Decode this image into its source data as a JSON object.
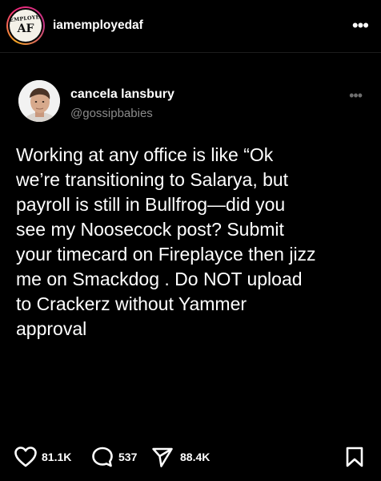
{
  "header": {
    "account_handle": "iamemployedaf",
    "more_icon": "more-horizontal-icon",
    "logo": {
      "top_text": "EMPLOYED",
      "bottom_text": "AF"
    }
  },
  "tweet": {
    "display_name": "cancela lansbury",
    "username": "@gossipbabies",
    "more_icon": "more-horizontal-icon",
    "text": "Working at any office is like “Ok\nwe’re transitioning to Salarya, but\npayroll is still in Bullfrog—did you\nsee my Noosecock post? Submit\nyour timecard on Fireplayce then jizz\nme on Smackdog . Do NOT upload\nto Crackerz without Yammer\napproval"
  },
  "actions": {
    "like_count": "81.1K",
    "comment_count": "537",
    "share_count": "88.4K",
    "like_icon": "heart-icon",
    "comment_icon": "comment-bubble-icon",
    "share_icon": "send-icon",
    "save_icon": "bookmark-icon"
  },
  "colors": {
    "background": "#000000",
    "text": "#ffffff",
    "muted_text": "#8b8b8b"
  }
}
